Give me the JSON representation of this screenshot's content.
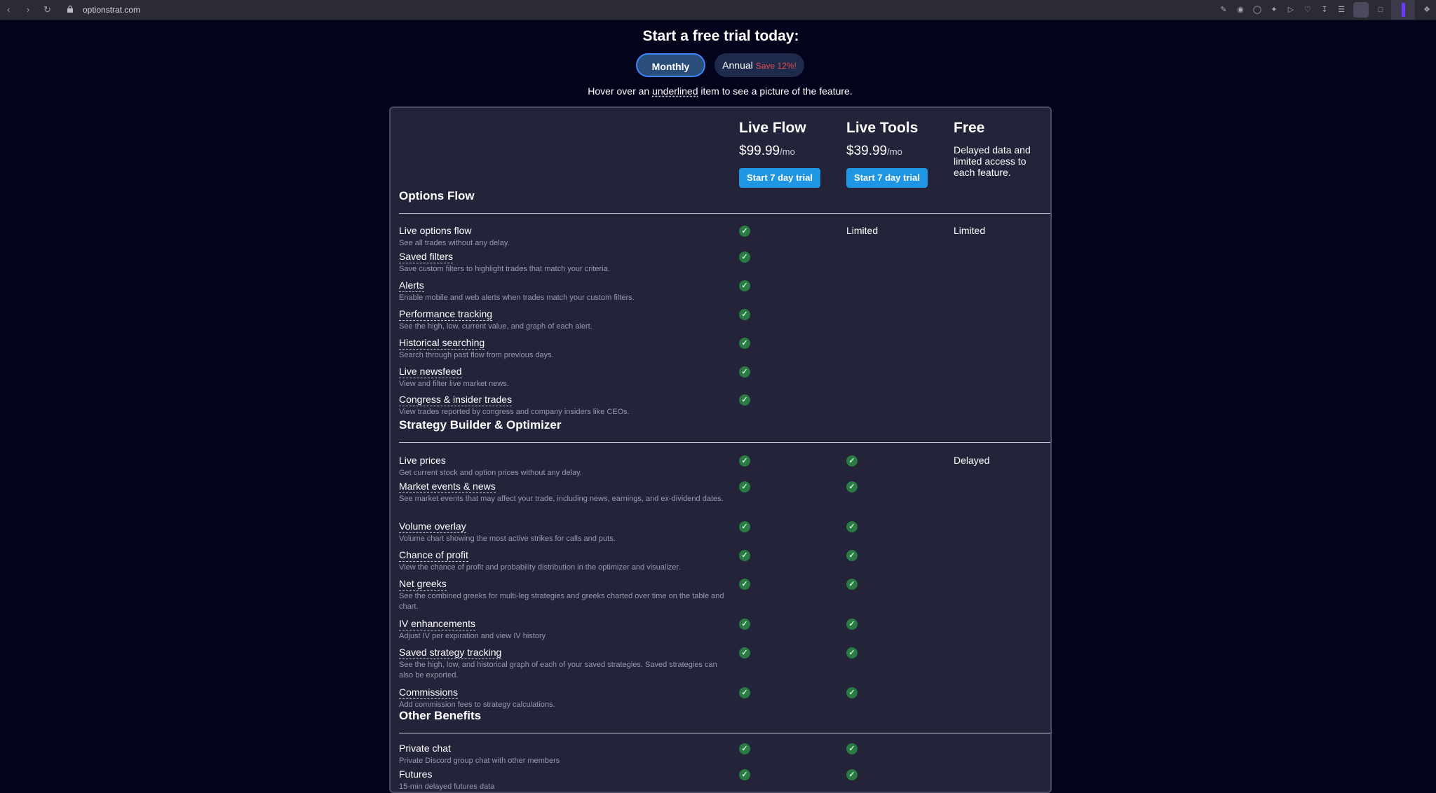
{
  "browser": {
    "url": "optionstrat.com",
    "nav": [
      "back-icon",
      "forward-icon",
      "reload-icon"
    ]
  },
  "header": {
    "title": "Start a free trial today:",
    "toggle_monthly": "Monthly",
    "toggle_annual": "Annual",
    "toggle_annual_save": "Save 12%!",
    "hover_prefix": "Hover over an",
    "hover_underlined": "underlined",
    "hover_suffix": "item to see a picture of the feature."
  },
  "plans": [
    {
      "name": "Live Flow",
      "price": "$99.99",
      "per": "/mo",
      "button": "Start 7 day trial"
    },
    {
      "name": "Live Tools",
      "price": "$39.99",
      "per": "/mo",
      "button": "Start 7 day trial"
    },
    {
      "name": "Free",
      "description": "Delayed data and limited access to each feature."
    }
  ],
  "sections": [
    {
      "title": "Options Flow",
      "features": [
        {
          "name": "Live options flow",
          "desc": "See all trades without any delay.",
          "underlined": false,
          "live_flow": "check",
          "live_tools": "Limited",
          "free": "Limited"
        },
        {
          "name": "Saved filters",
          "desc": "Save custom filters to highlight trades that match your criteria.",
          "underlined": true,
          "live_flow": "check",
          "live_tools": "",
          "free": ""
        },
        {
          "name": "Alerts",
          "desc": "Enable mobile and web alerts when trades match your custom filters.",
          "underlined": true,
          "live_flow": "check",
          "live_tools": "",
          "free": ""
        },
        {
          "name": "Performance tracking",
          "desc": "See the high, low, current value, and graph of each alert.",
          "underlined": true,
          "live_flow": "check",
          "live_tools": "",
          "free": ""
        },
        {
          "name": "Historical searching",
          "desc": "Search through past flow from previous days.",
          "underlined": true,
          "live_flow": "check",
          "live_tools": "",
          "free": ""
        },
        {
          "name": "Live newsfeed",
          "desc": "View and filter live market news.",
          "underlined": true,
          "live_flow": "check",
          "live_tools": "",
          "free": ""
        },
        {
          "name": "Congress & insider trades",
          "desc": "View trades reported by congress and company insiders like CEOs.",
          "underlined": true,
          "live_flow": "check",
          "live_tools": "",
          "free": ""
        }
      ]
    },
    {
      "title": "Strategy Builder & Optimizer",
      "features": [
        {
          "name": "Live prices",
          "desc": "Get current stock and option prices without any delay.",
          "underlined": false,
          "live_flow": "check",
          "live_tools": "check",
          "free": "Delayed"
        },
        {
          "name": "Market events & news",
          "desc": "See market events that may affect your trade, including news, earnings, and ex-dividend dates.",
          "underlined": true,
          "live_flow": "check",
          "live_tools": "check",
          "free": ""
        },
        {
          "name": "Volume overlay",
          "desc": "Volume chart showing the most active strikes for calls and puts.",
          "underlined": true,
          "live_flow": "check",
          "live_tools": "check",
          "free": ""
        },
        {
          "name": "Chance of profit",
          "desc": "View the chance of profit and probability distribution in the optimizer and visualizer.",
          "underlined": true,
          "live_flow": "check",
          "live_tools": "check",
          "free": ""
        },
        {
          "name": "Net greeks",
          "desc": "See the combined greeks for multi-leg strategies and greeks charted over time on the table and chart.",
          "underlined": true,
          "live_flow": "check",
          "live_tools": "check",
          "free": ""
        },
        {
          "name": "IV enhancements",
          "desc": "Adjust IV per expiration and view IV history",
          "underlined": true,
          "live_flow": "check",
          "live_tools": "check",
          "free": ""
        },
        {
          "name": "Saved strategy tracking",
          "desc": "See the high, low, and historical graph of each of your saved strategies. Saved strategies can also be exported.",
          "underlined": true,
          "live_flow": "check",
          "live_tools": "check",
          "free": ""
        },
        {
          "name": "Commissions",
          "desc": "Add commission fees to strategy calculations.",
          "underlined": true,
          "live_flow": "check",
          "live_tools": "check",
          "free": ""
        }
      ]
    },
    {
      "title": "Other Benefits",
      "features": [
        {
          "name": "Private chat",
          "desc": "Private Discord group chat with other members",
          "underlined": false,
          "live_flow": "check",
          "live_tools": "check",
          "free": ""
        },
        {
          "name": "Futures",
          "desc": "15-min delayed futures data",
          "underlined": false,
          "live_flow": "check",
          "live_tools": "check",
          "free": ""
        }
      ]
    }
  ],
  "colors": {
    "background": "#03031c",
    "card": "#23233a",
    "button": "#1e96e4",
    "check": "#2a7a43",
    "save_text": "#e44b4b"
  }
}
